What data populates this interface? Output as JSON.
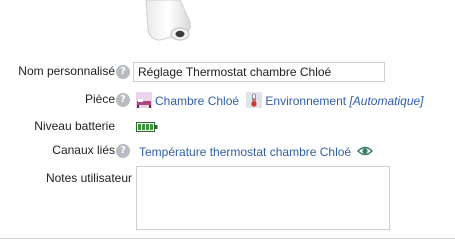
{
  "fields": {
    "custom_name": {
      "label": "Nom personnalisé",
      "value": "Réglage Thermostat chambre Chloé"
    },
    "room": {
      "label": "Pièce",
      "room_name": "Chambre Chloé",
      "category": "Environnement",
      "mode": "[Automatique]"
    },
    "battery": {
      "label": "Niveau batterie",
      "level": 1.0
    },
    "channels": {
      "label": "Canaux liés",
      "value": "Température thermostat chambre Chloé"
    },
    "notes": {
      "label": "Notes utilisateur",
      "value": ""
    }
  },
  "icons": {
    "help": "question-circle-icon",
    "room": "bedroom-icon",
    "environment": "thermometer-icon",
    "battery": "battery-icon",
    "view": "eye-icon"
  },
  "colors": {
    "link": "#2f5fa8",
    "battery": "#3a9a3a",
    "help": "#b7bcc2"
  }
}
